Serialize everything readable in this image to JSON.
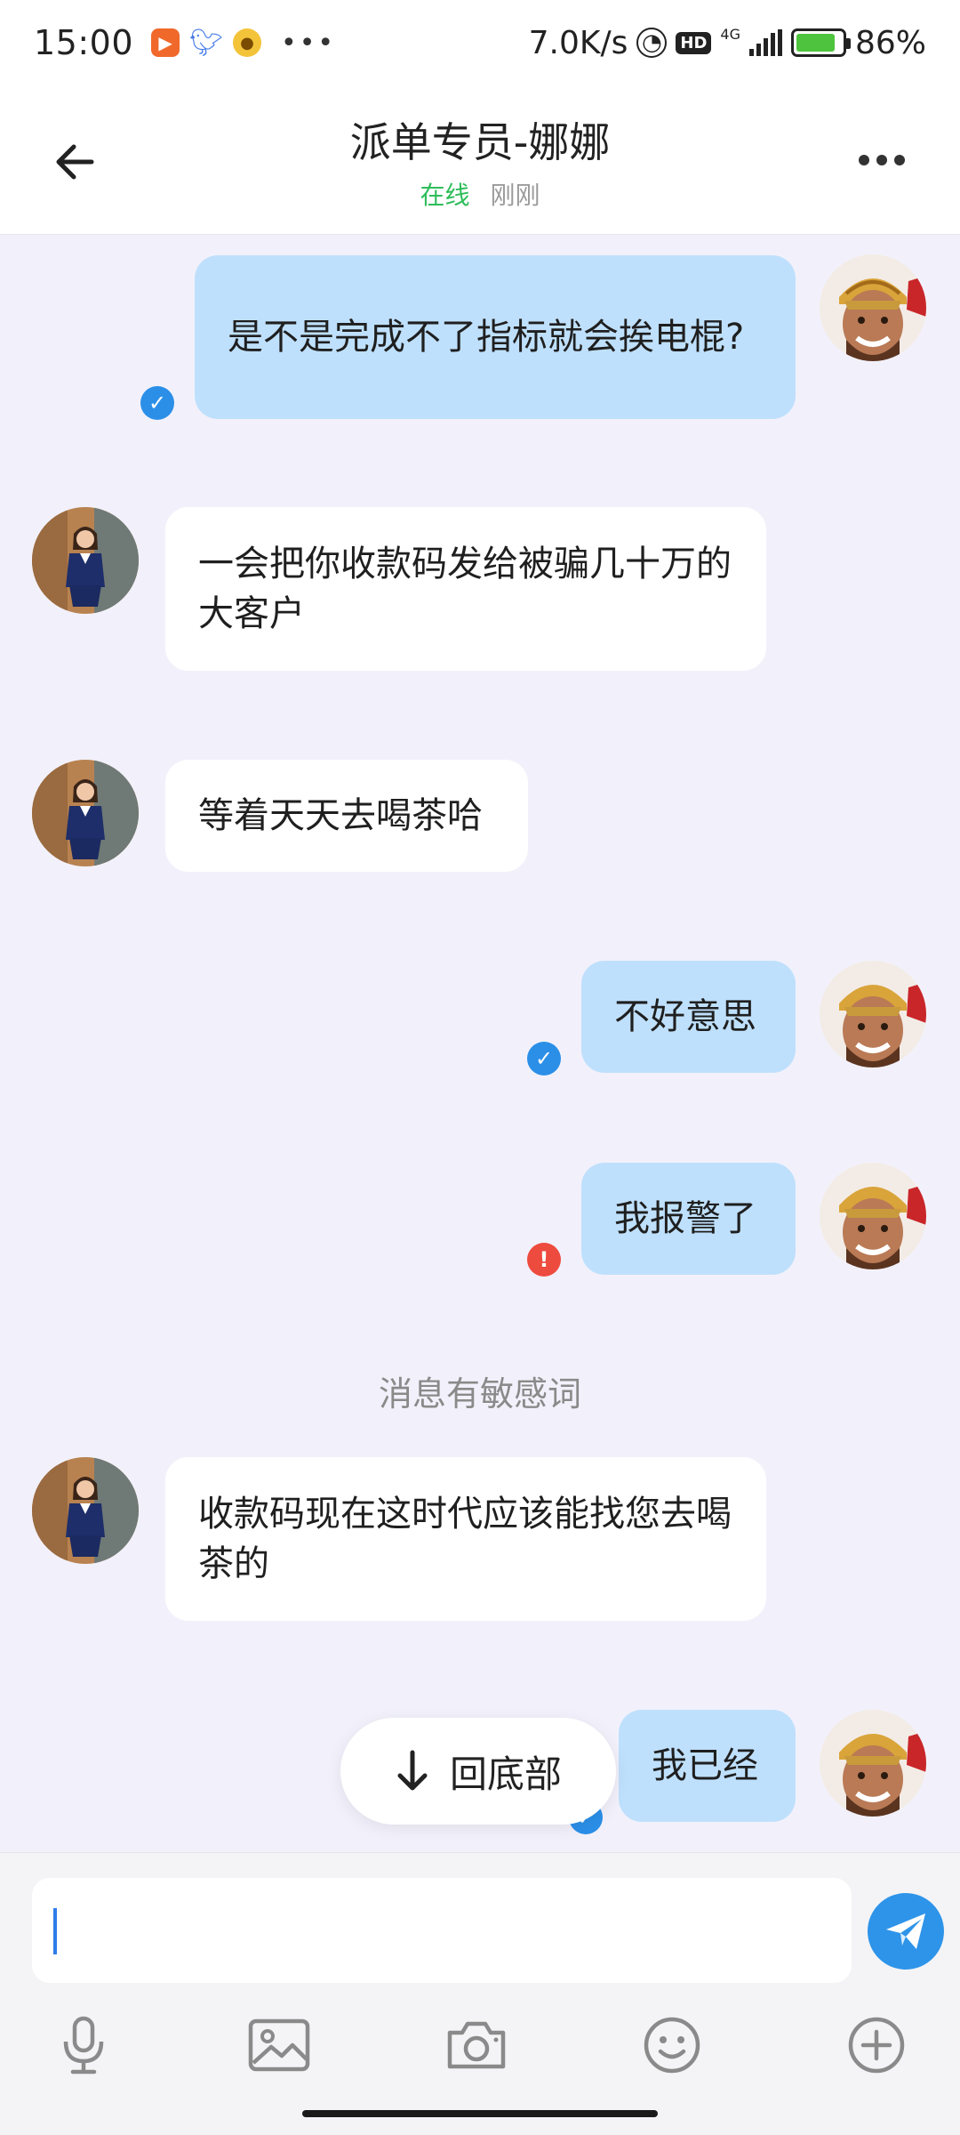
{
  "status_bar": {
    "time": "15:00",
    "net_speed": "7.0K/s",
    "network": "4G",
    "hd": "HD",
    "battery": "86%",
    "battery_level": 0.86
  },
  "header": {
    "title": "派单专员-娜娜",
    "online": "在线",
    "last_seen": "刚刚"
  },
  "messages": [
    {
      "from": "me",
      "text": "是不是完成不了指标就会挨电棍?",
      "status": "sent"
    },
    {
      "from": "other",
      "text": "一会把你收款码发给被骗几十万的大客户"
    },
    {
      "from": "other",
      "text": "等着天天去喝茶哈"
    },
    {
      "from": "me",
      "text": "不好意思",
      "status": "sent"
    },
    {
      "from": "me",
      "text": "我报警了",
      "status": "failed"
    },
    {
      "from": "other",
      "text": "收款码现在这时代应该能找您去喝茶的"
    },
    {
      "from": "me",
      "text": "我已经",
      "status": "sent"
    }
  ],
  "system_notice": "消息有敏感词",
  "scroll_to_bottom_label": "回底部",
  "composer": {
    "value": "",
    "tools": [
      "microphone-icon",
      "image-icon",
      "camera-icon",
      "emoji-icon",
      "plus-icon"
    ]
  },
  "colors": {
    "my_bubble": "#bfe0fc",
    "their_bubble": "#ffffff",
    "online": "#2ebd5a",
    "send": "#2e94e9",
    "error": "#ee4b3f"
  }
}
